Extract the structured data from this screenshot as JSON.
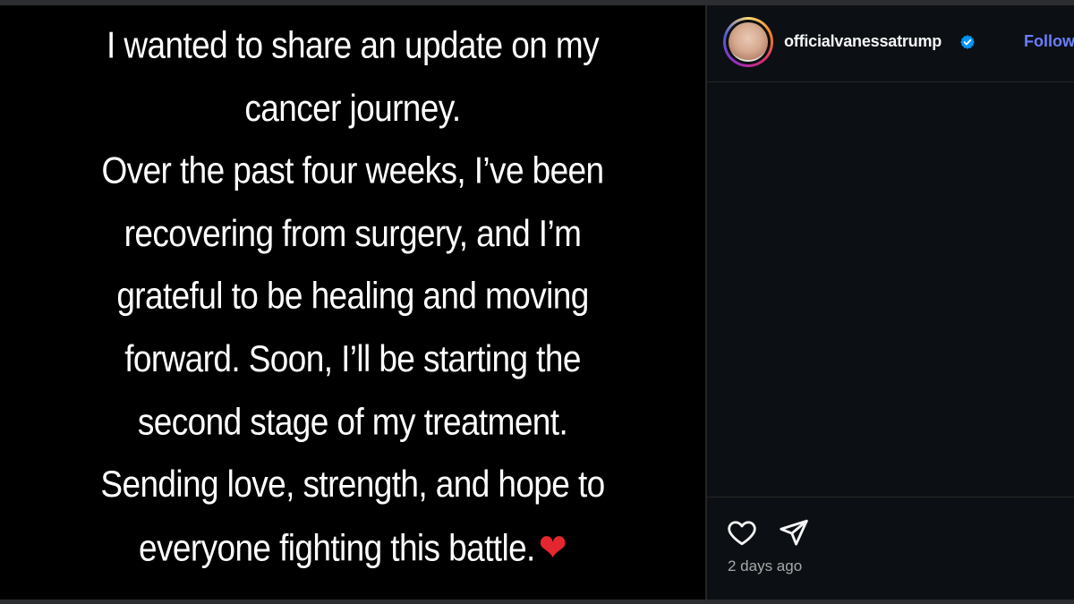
{
  "post": {
    "text_lines": [
      "I wanted to share an update on my",
      "cancer journey.",
      "Over the past four weeks, I’ve been",
      "recovering from surgery, and I’m",
      "grateful to be healing and moving",
      "forward. Soon, I’ll be starting the",
      "second stage of my treatment.",
      "Sending love, strength, and hope to",
      "everyone fighting this battle."
    ],
    "emoji": "❤"
  },
  "header": {
    "username": "officialvanessatrump",
    "follow_label": "Follow"
  },
  "footer": {
    "timestamp": "2 days ago"
  },
  "colors": {
    "background": "#000000",
    "sidebar": "#0c1014",
    "follow": "#6b7dff",
    "verified": "#0095f6",
    "heart": "#e3262f"
  },
  "icons": {
    "like": "heart-outline-icon",
    "share": "paper-plane-icon",
    "verified": "verified-badge-icon"
  }
}
